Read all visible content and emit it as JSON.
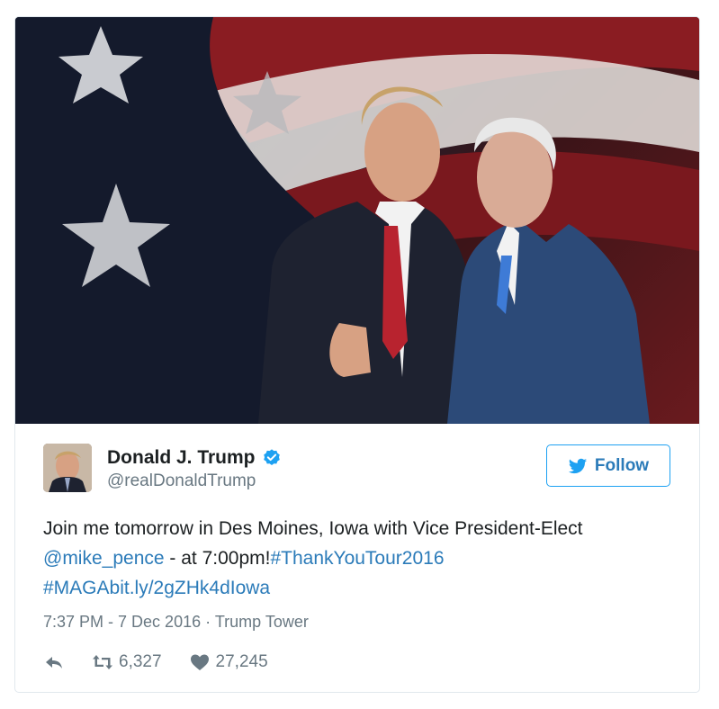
{
  "tweet": {
    "author": {
      "name": "Donald J. Trump",
      "handle": "@realDonaldTrump",
      "verified": true
    },
    "follow_label": "Follow",
    "text": {
      "line1": "Join me tomorrow in Des Moines, Iowa with Vice President-Elect",
      "mention": "@mike_pence",
      "middle": " - at 7:00pm!",
      "hashtag1": "#ThankYouTour2016",
      "hashtag2": "#MAGA",
      "url": "bit.ly/2gZHk4dIowa"
    },
    "timestamp": "7:37 PM - 7 Dec 2016",
    "separator": "·",
    "location": "Trump Tower",
    "retweets": "6,327",
    "likes": "27,245"
  },
  "icons": {
    "verified": "verified-badge-icon",
    "follow_bird": "twitter-bird-icon",
    "reply": "reply-icon",
    "retweet": "retweet-icon",
    "like": "heart-icon"
  },
  "colors": {
    "link": "#2b7bb9",
    "twitter_blue": "#1da1f2",
    "secondary_text": "#697882",
    "border": "#e1e8ed"
  }
}
